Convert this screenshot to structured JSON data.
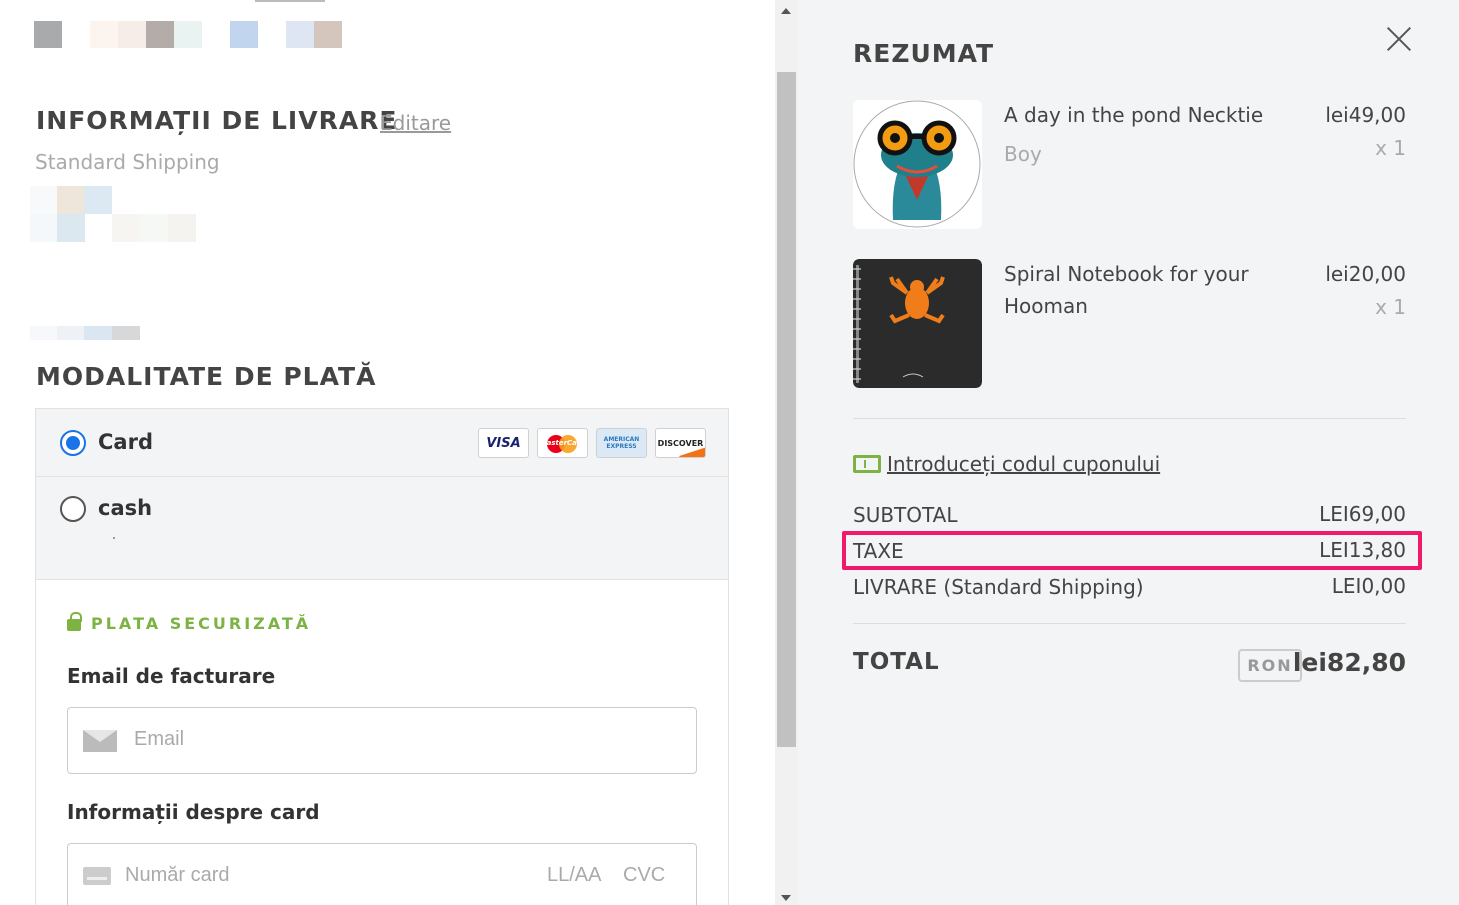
{
  "delivery": {
    "title": "INFORMAȚII DE LIVRARE",
    "edit_label": "Editare",
    "shipping_method": "Standard Shipping"
  },
  "payment": {
    "title": "MODALITATE DE PLATĂ",
    "options": [
      {
        "label": "Card",
        "selected": true
      },
      {
        "label": "cash",
        "selected": false
      }
    ],
    "card_brands": [
      "VISA",
      "MasterCard",
      "AMERICAN EXPRESS",
      "DISCOVER"
    ],
    "secure_label": "PLATA SECURIZATĂ",
    "email_label": "Email de facturare",
    "email_placeholder": "Email",
    "card_info_label": "Informații despre card",
    "card_number_placeholder": "Număr card",
    "expiry_placeholder": "LL/AA",
    "cvc_placeholder": "CVC"
  },
  "summary": {
    "title": "REZUMAT",
    "items": [
      {
        "name": "A day in the pond Necktie",
        "variant": "Boy",
        "price": "lei49,00",
        "qty": "x 1"
      },
      {
        "name": "Spiral Notebook for your Hooman",
        "variant": "",
        "price": "lei20,00",
        "qty": "x 1"
      }
    ],
    "coupon_label": "Introduceți codul cuponului",
    "rows": [
      {
        "label": "SUBTOTAL",
        "value": "LEI69,00"
      },
      {
        "label": "TAXE",
        "value": "LEI13,80"
      },
      {
        "label": "LIVRARE",
        "sub": "(Standard Shipping)",
        "value": "LEI0,00"
      }
    ],
    "total_label": "TOTAL",
    "currency": "RON",
    "total_value": "lei82,80"
  },
  "colors": {
    "accent_blue": "#1a73e8",
    "secure_green": "#7cb342",
    "highlight_pink": "#f0196b"
  }
}
